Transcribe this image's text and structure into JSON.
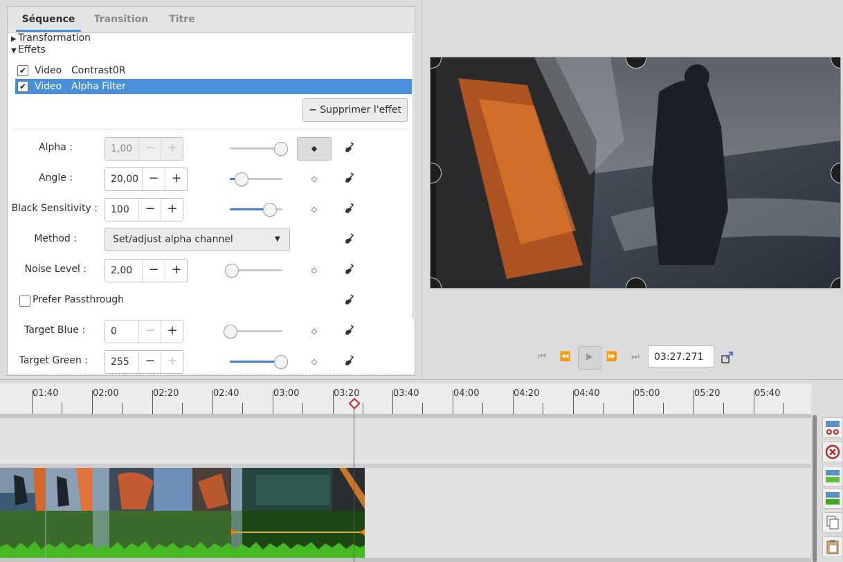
{
  "tabs": [
    "Séquence",
    "Transition",
    "Titre"
  ],
  "tree": {
    "transformation": "Transformation",
    "effects": "Effets"
  },
  "effects": [
    {
      "type": "Video",
      "name": "Contrast0R",
      "checked": true
    },
    {
      "type": "Video",
      "name": "Alpha Filter",
      "checked": true,
      "selected": true
    }
  ],
  "remove_effect_label": "Supprimer l'effet",
  "params": {
    "alpha": {
      "label": "Alpha :",
      "value": "1,00",
      "level": 1.0
    },
    "angle": {
      "label": "Angle :",
      "value": "20,00",
      "level": 0.1
    },
    "black_sensitivity": {
      "label": "Black Sensitivity :",
      "value": "100",
      "level": 0.8
    },
    "method": {
      "label": "Method :",
      "value": "Set/adjust alpha channel"
    },
    "noise_level": {
      "label": "Noise Level :",
      "value": "2,00",
      "level": 0.0
    },
    "prefer_passthrough": {
      "label": "Prefer Passthrough",
      "checked": false
    },
    "target_blue": {
      "label": "Target Blue :",
      "value": "0",
      "level": 0.0
    },
    "target_green": {
      "label": "Target Green :",
      "value": "255",
      "level": 1.0
    }
  },
  "transport": {
    "timecode": "03:27.271"
  },
  "ruler_labels": [
    "01:40",
    "02:00",
    "02:20",
    "02:40",
    "03:00",
    "03:20",
    "03:40",
    "04:00",
    "04:20",
    "04:40",
    "05:00",
    "05:20",
    "05:40"
  ],
  "colors": {
    "accent": "#4a90d9",
    "playhead": "#e02020",
    "audio": "#3fa81f",
    "keyframe": "#ff7a00"
  }
}
